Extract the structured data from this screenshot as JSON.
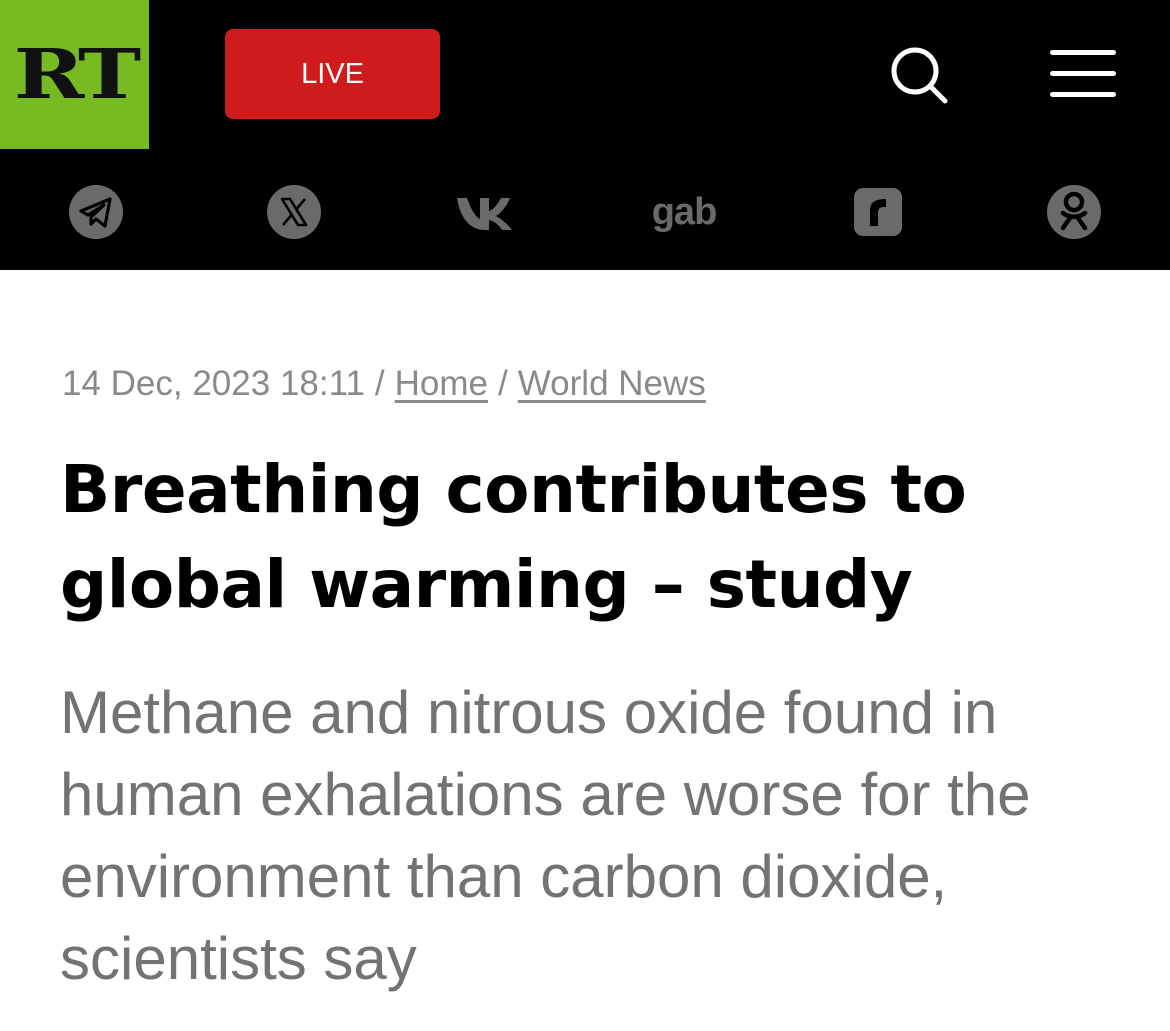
{
  "header": {
    "logo_text": "RT",
    "live_label": "LIVE",
    "search_icon": "search-icon",
    "menu_icon": "hamburger-menu-icon"
  },
  "social": [
    {
      "name": "telegram",
      "icon": "telegram-icon"
    },
    {
      "name": "x",
      "icon": "x-icon"
    },
    {
      "name": "vk",
      "icon": "vk-icon"
    },
    {
      "name": "gab",
      "icon": "gab-icon",
      "text": "gab"
    },
    {
      "name": "rumble",
      "icon": "rumble-icon"
    },
    {
      "name": "odnoklassniki",
      "icon": "odnoklassniki-icon"
    }
  ],
  "article": {
    "timestamp": "14 Dec, 2023 18:11",
    "breadcrumb": [
      "Home",
      "World News"
    ],
    "separator": "/",
    "title": "Breathing contributes to global warming – study",
    "summary": "Methane and nitrous oxide found in human exhalations are worse for the environment than carbon dioxide, scientists say"
  },
  "colors": {
    "brand_green": "#77bb22",
    "live_red": "#cf1b1b",
    "icon_gray": "#6a6a6a",
    "meta_gray": "#8a8a8a",
    "summary_gray": "#737373"
  }
}
